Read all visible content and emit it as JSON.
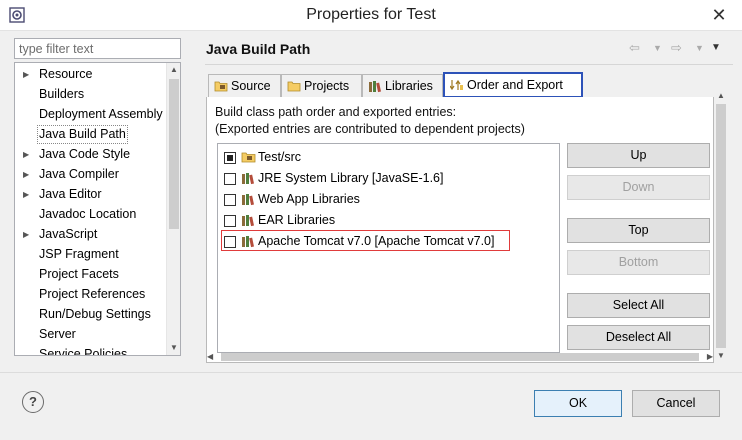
{
  "window": {
    "title": "Properties for Test",
    "close_label": "✕"
  },
  "filter": {
    "placeholder": "type filter text",
    "value": ""
  },
  "tree": {
    "items": [
      {
        "label": "Resource",
        "expandable": true
      },
      {
        "label": "Builders",
        "expandable": false
      },
      {
        "label": "Deployment Assembly",
        "expandable": false
      },
      {
        "label": "Java Build Path",
        "expandable": false,
        "selected": true
      },
      {
        "label": "Java Code Style",
        "expandable": true
      },
      {
        "label": "Java Compiler",
        "expandable": true
      },
      {
        "label": "Java Editor",
        "expandable": true
      },
      {
        "label": "Javadoc Location",
        "expandable": false
      },
      {
        "label": "JavaScript",
        "expandable": true
      },
      {
        "label": "JSP Fragment",
        "expandable": false
      },
      {
        "label": "Project Facets",
        "expandable": false
      },
      {
        "label": "Project References",
        "expandable": false
      },
      {
        "label": "Run/Debug Settings",
        "expandable": false
      },
      {
        "label": "Server",
        "expandable": false
      },
      {
        "label": "Service Policies",
        "expandable": false
      }
    ]
  },
  "page": {
    "title": "Java Build Path"
  },
  "tabs": [
    {
      "label": "Source",
      "icon": "folder-source-icon"
    },
    {
      "label": "Projects",
      "icon": "projects-icon"
    },
    {
      "label": "Libraries",
      "icon": "libraries-icon"
    },
    {
      "label": "Order and Export",
      "icon": "order-export-icon",
      "active": true
    }
  ],
  "description": {
    "line1": "Build class path order and exported entries:",
    "line2": "(Exported entries are contributed to dependent projects)"
  },
  "entries": [
    {
      "label": "Test/src",
      "checked": true,
      "icon": "source-folder-icon"
    },
    {
      "label": "JRE System Library [JavaSE-1.6]",
      "checked": false,
      "icon": "library-icon"
    },
    {
      "label": "Web App Libraries",
      "checked": false,
      "icon": "library-icon"
    },
    {
      "label": "EAR Libraries",
      "checked": false,
      "icon": "library-icon"
    },
    {
      "label": "Apache Tomcat v7.0 [Apache Tomcat v7.0]",
      "checked": false,
      "icon": "library-icon",
      "highlighted": true
    }
  ],
  "buttons": {
    "up": "Up",
    "down": "Down",
    "top": "Top",
    "bottom": "Bottom",
    "select_all": "Select All",
    "deselect_all": "Deselect All"
  },
  "footer": {
    "help": "?",
    "ok": "OK",
    "cancel": "Cancel"
  }
}
